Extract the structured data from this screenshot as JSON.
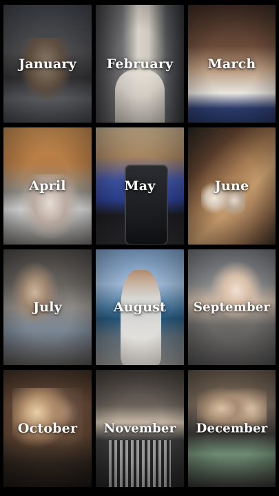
{
  "months": [
    {
      "label": "January"
    },
    {
      "label": "February"
    },
    {
      "label": "March"
    },
    {
      "label": "April"
    },
    {
      "label": "May"
    },
    {
      "label": "June"
    },
    {
      "label": "July"
    },
    {
      "label": "August"
    },
    {
      "label": "September"
    },
    {
      "label": "October"
    },
    {
      "label": "November"
    },
    {
      "label": "December"
    }
  ]
}
